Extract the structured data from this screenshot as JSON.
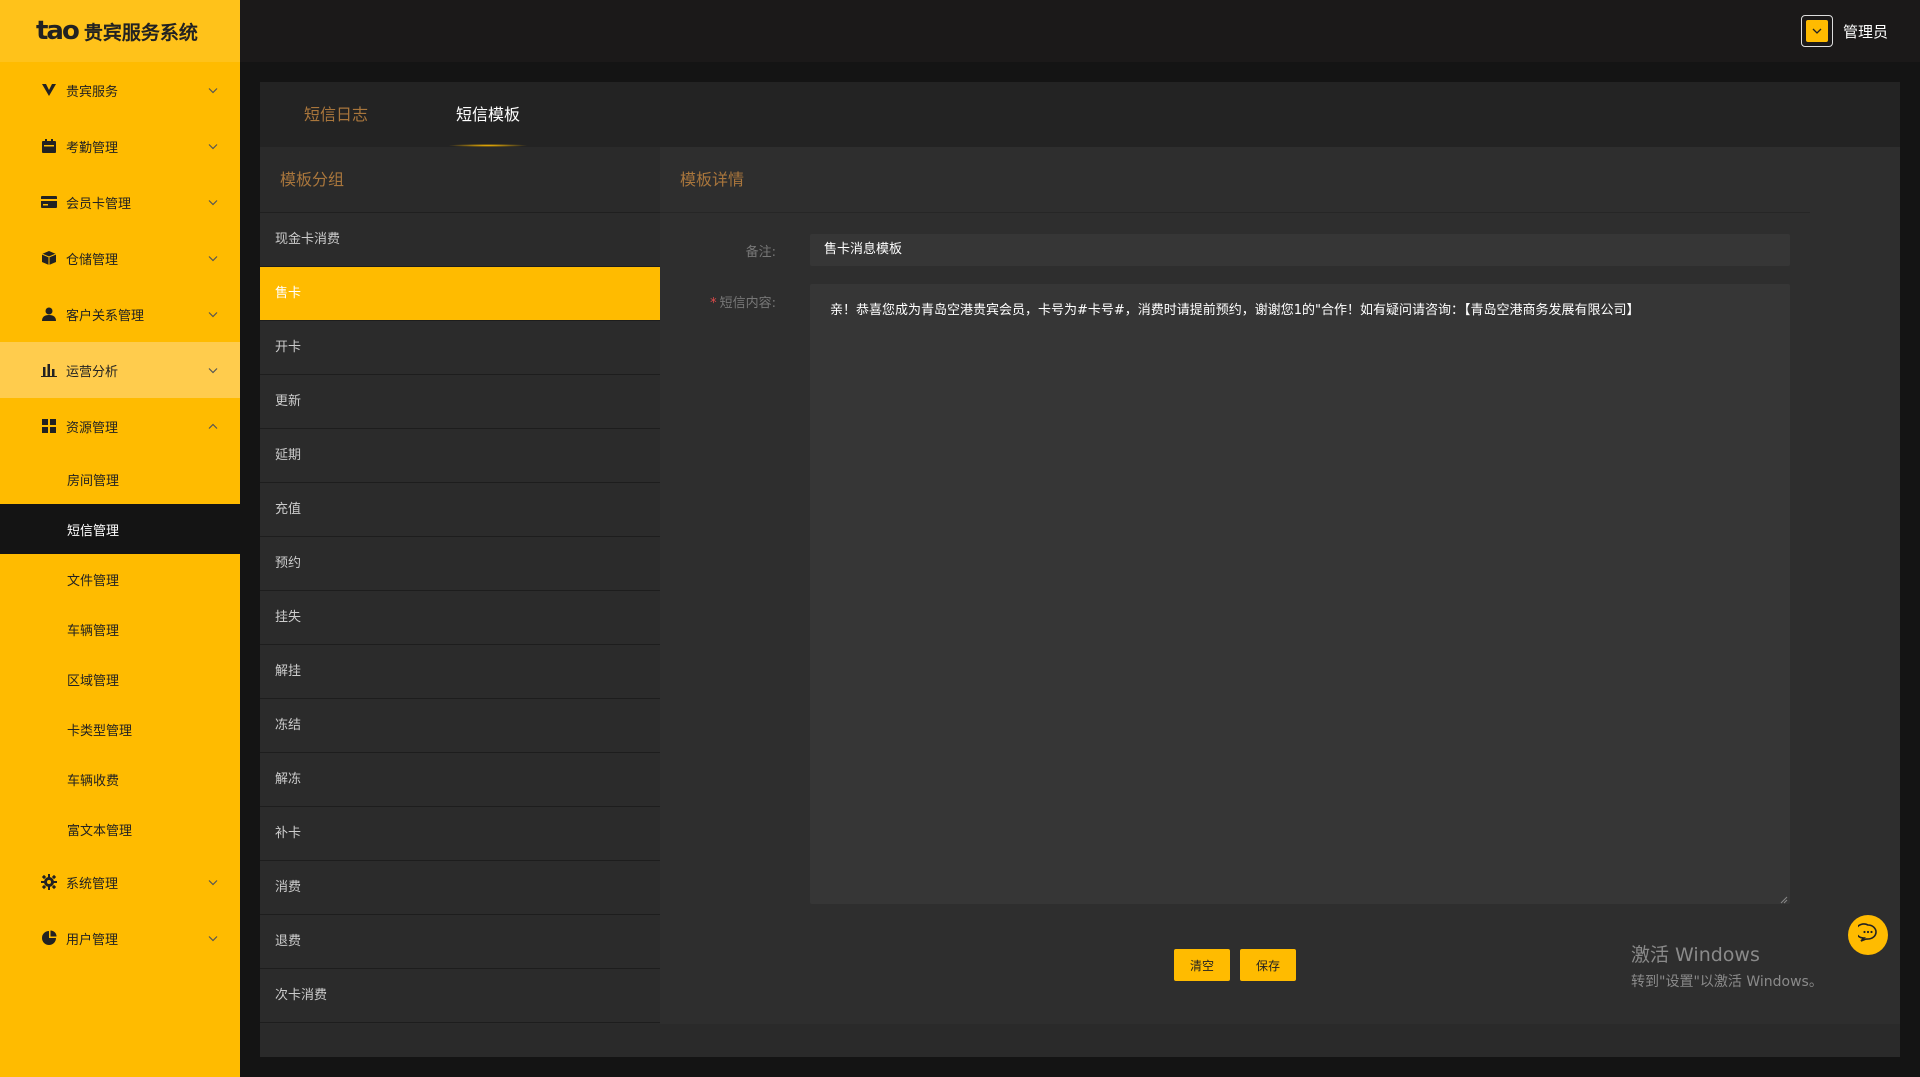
{
  "app": {
    "logo_mark": "tao",
    "title": "贵宾服务系统"
  },
  "user": {
    "name": "管理员"
  },
  "sidebar": {
    "items": [
      {
        "label": "贵宾服务",
        "icon": "v-icon"
      },
      {
        "label": "考勤管理",
        "icon": "calendar-icon"
      },
      {
        "label": "会员卡管理",
        "icon": "card-icon"
      },
      {
        "label": "仓储管理",
        "icon": "box-icon"
      },
      {
        "label": "客户关系管理",
        "icon": "person-icon"
      },
      {
        "label": "运营分析",
        "icon": "bar-chart-icon"
      },
      {
        "label": "资源管理",
        "icon": "grid-icon"
      }
    ],
    "sub_items": [
      "房间管理",
      "短信管理",
      "文件管理",
      "车辆管理",
      "区域管理",
      "卡类型管理",
      "车辆收费",
      "富文本管理"
    ],
    "bottom_items": [
      {
        "label": "系统管理",
        "icon": "gear-icon"
      },
      {
        "label": "用户管理",
        "icon": "pie-chart-icon"
      }
    ]
  },
  "tabs": [
    "短信日志",
    "短信模板"
  ],
  "groups": {
    "title": "模板分组",
    "items": [
      "现金卡消费",
      "售卡",
      "开卡",
      "更新",
      "延期",
      "充值",
      "预约",
      "挂失",
      "解挂",
      "冻结",
      "解冻",
      "补卡",
      "消费",
      "退费",
      "次卡消费"
    ]
  },
  "detail": {
    "title": "模板详情",
    "remark_label": "备注:",
    "remark_value": "售卡消息模板",
    "required_mark": "*",
    "content_label": "短信内容:",
    "content_value": "亲！恭喜您成为青岛空港贵宾会员，卡号为#卡号#，消费时请提前预约，谢谢您1的\"合作！如有疑问请咨询：【青岛空港商务发展有限公司】",
    "clear_label": "清空",
    "save_label": "保存"
  },
  "watermark": {
    "line1": "激活 Windows",
    "line2": "转到\"设置\"以激活 Windows。"
  },
  "colors": {
    "accent": "#ffbb00",
    "tab_inactive": "#a9763c",
    "background": "#141414"
  }
}
